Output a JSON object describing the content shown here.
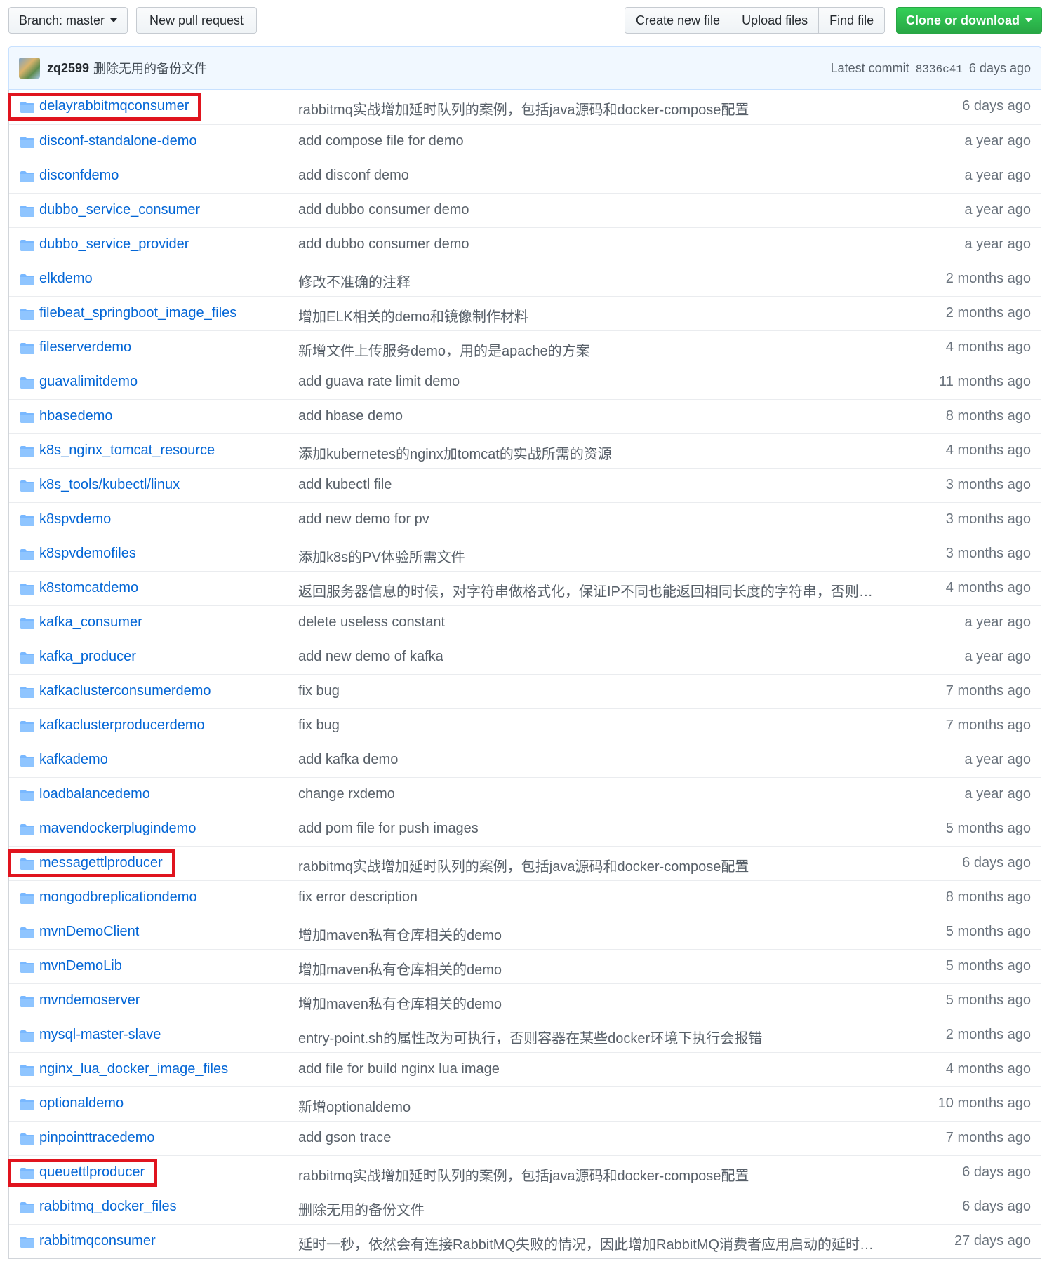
{
  "toolbar": {
    "branch_label": "Branch: master",
    "new_pr_label": "New pull request",
    "create_file_label": "Create new file",
    "upload_label": "Upload files",
    "find_label": "Find file",
    "clone_label": "Clone or download"
  },
  "commit": {
    "author": "zq2599",
    "message": "删除无用的备份文件",
    "latest_prefix": "Latest commit",
    "sha": "8336c41",
    "age": "6 days ago"
  },
  "files": [
    {
      "name": "delayrabbitmqconsumer",
      "message": "rabbitmq实战增加延时队列的案例，包括java源码和docker-compose配置",
      "age": "6 days ago",
      "highlighted": true
    },
    {
      "name": "disconf-standalone-demo",
      "message": "add compose file for demo",
      "age": "a year ago"
    },
    {
      "name": "disconfdemo",
      "message": "add disconf demo",
      "age": "a year ago"
    },
    {
      "name": "dubbo_service_consumer",
      "message": "add dubbo consumer demo",
      "age": "a year ago"
    },
    {
      "name": "dubbo_service_provider",
      "message": "add dubbo consumer demo",
      "age": "a year ago"
    },
    {
      "name": "elkdemo",
      "message": "修改不准确的注释",
      "age": "2 months ago"
    },
    {
      "name": "filebeat_springboot_image_files",
      "message": "增加ELK相关的demo和镜像制作材料",
      "age": "2 months ago"
    },
    {
      "name": "fileserverdemo",
      "message": "新增文件上传服务demo，用的是apache的方案",
      "age": "4 months ago"
    },
    {
      "name": "guavalimitdemo",
      "message": "add guava rate limit demo",
      "age": "11 months ago"
    },
    {
      "name": "hbasedemo",
      "message": "add hbase demo",
      "age": "8 months ago"
    },
    {
      "name": "k8s_nginx_tomcat_resource",
      "message": "添加kubernetes的nginx加tomcat的实战所需的资源",
      "age": "4 months ago"
    },
    {
      "name": "k8s_tools/kubectl/linux",
      "message": "add kubectl file",
      "age": "3 months ago"
    },
    {
      "name": "k8spvdemo",
      "message": "add new demo for pv",
      "age": "3 months ago"
    },
    {
      "name": "k8spvdemofiles",
      "message": "添加k8s的PV体验所需文件",
      "age": "3 months ago"
    },
    {
      "name": "k8stomcatdemo",
      "message": "返回服务器信息的时候，对字符串做格式化，保证IP不同也能返回相同长度的字符串，否则…",
      "age": "4 months ago"
    },
    {
      "name": "kafka_consumer",
      "message": "delete useless constant",
      "age": "a year ago"
    },
    {
      "name": "kafka_producer",
      "message": "add new demo of kafka",
      "age": "a year ago"
    },
    {
      "name": "kafkaclusterconsumerdemo",
      "message": "fix bug",
      "age": "7 months ago"
    },
    {
      "name": "kafkaclusterproducerdemo",
      "message": "fix bug",
      "age": "7 months ago"
    },
    {
      "name": "kafkademo",
      "message": "add kafka demo",
      "age": "a year ago"
    },
    {
      "name": "loadbalancedemo",
      "message": "change rxdemo",
      "age": "a year ago"
    },
    {
      "name": "mavendockerplugindemo",
      "message": "add pom file for push images",
      "age": "5 months ago"
    },
    {
      "name": "messagettlproducer",
      "message": "rabbitmq实战增加延时队列的案例，包括java源码和docker-compose配置",
      "age": "6 days ago",
      "highlighted": true
    },
    {
      "name": "mongodbreplicationdemo",
      "message": "fix error description",
      "age": "8 months ago"
    },
    {
      "name": "mvnDemoClient",
      "message": "增加maven私有仓库相关的demo",
      "age": "5 months ago"
    },
    {
      "name": "mvnDemoLib",
      "message": "增加maven私有仓库相关的demo",
      "age": "5 months ago"
    },
    {
      "name": "mvndemoserver",
      "message": "增加maven私有仓库相关的demo",
      "age": "5 months ago"
    },
    {
      "name": "mysql-master-slave",
      "message": "entry-point.sh的属性改为可执行，否则容器在某些docker环境下执行会报错",
      "age": "2 months ago"
    },
    {
      "name": "nginx_lua_docker_image_files",
      "message": "add file for build nginx lua image",
      "age": "4 months ago"
    },
    {
      "name": "optionaldemo",
      "message": "新增optionaldemo",
      "age": "10 months ago"
    },
    {
      "name": "pinpointtracedemo",
      "message": "add gson trace",
      "age": "7 months ago"
    },
    {
      "name": "queuettlproducer",
      "message": "rabbitmq实战增加延时队列的案例，包括java源码和docker-compose配置",
      "age": "6 days ago",
      "highlighted": true
    },
    {
      "name": "rabbitmq_docker_files",
      "message": "删除无用的备份文件",
      "age": "6 days ago"
    },
    {
      "name": "rabbitmqconsumer",
      "message": "延时一秒，依然会有连接RabbitMQ失败的情况，因此增加RabbitMQ消费者应用启动的延时…",
      "age": "27 days ago"
    }
  ],
  "colors": {
    "link": "#0366d6",
    "folder_icon": "#79b8ff",
    "highlight_box": "#e0141e",
    "clone_button": "#28a745"
  }
}
